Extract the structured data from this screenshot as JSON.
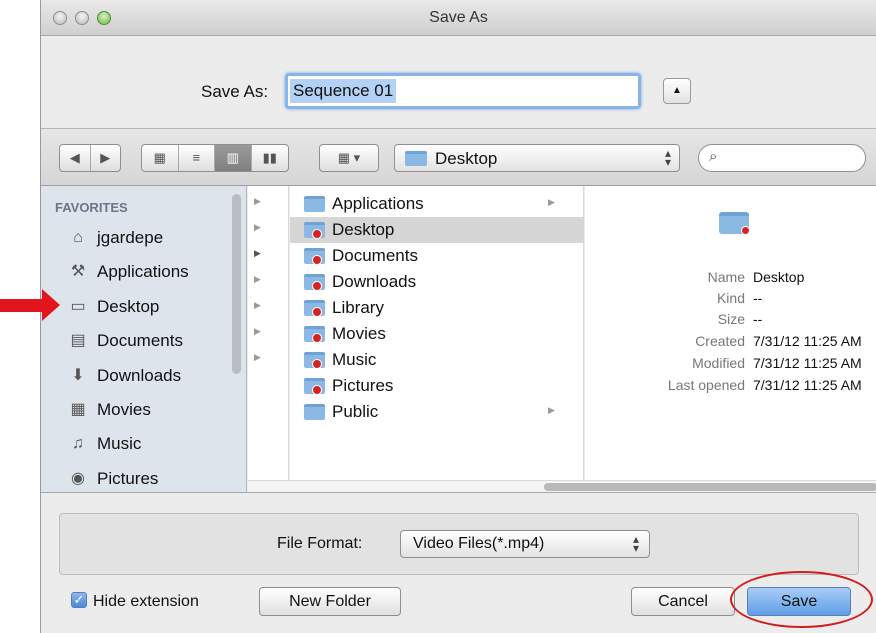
{
  "window": {
    "title": "Save As"
  },
  "save_as": {
    "label": "Save As:",
    "filename": "Sequence 01"
  },
  "toolbar": {
    "back_icon": "back-arrow-icon",
    "forward_icon": "forward-arrow-icon",
    "location": "Desktop",
    "search_placeholder": ""
  },
  "sidebar": {
    "header": "FAVORITES",
    "items": [
      {
        "label": "jgardepe",
        "icon": "home-icon"
      },
      {
        "label": "Applications",
        "icon": "applications-icon"
      },
      {
        "label": "Desktop",
        "icon": "desktop-icon"
      },
      {
        "label": "Documents",
        "icon": "documents-icon"
      },
      {
        "label": "Downloads",
        "icon": "downloads-icon"
      },
      {
        "label": "Movies",
        "icon": "movies-icon"
      },
      {
        "label": "Music",
        "icon": "music-icon"
      },
      {
        "label": "Pictures",
        "icon": "pictures-icon"
      }
    ]
  },
  "browser": {
    "items": [
      {
        "label": "Applications",
        "badge": false,
        "chevron": true
      },
      {
        "label": "Desktop",
        "badge": true,
        "chevron": false,
        "selected": true
      },
      {
        "label": "Documents",
        "badge": true,
        "chevron": false
      },
      {
        "label": "Downloads",
        "badge": true,
        "chevron": false
      },
      {
        "label": "Library",
        "badge": true,
        "chevron": false
      },
      {
        "label": "Movies",
        "badge": true,
        "chevron": false
      },
      {
        "label": "Music",
        "badge": true,
        "chevron": false
      },
      {
        "label": "Pictures",
        "badge": true,
        "chevron": false
      },
      {
        "label": "Public",
        "badge": false,
        "chevron": true
      }
    ]
  },
  "preview": {
    "name_label": "Name",
    "name_value": "Desktop",
    "kind_label": "Kind",
    "kind_value": "--",
    "size_label": "Size",
    "size_value": "--",
    "created_label": "Created",
    "created_value": "7/31/12 11:25 AM",
    "modified_label": "Modified",
    "modified_value": "7/31/12 11:25 AM",
    "opened_label": "Last opened",
    "opened_value": "7/31/12 11:25 AM"
  },
  "format": {
    "label": "File Format:",
    "value": "Video Files(*.mp4)"
  },
  "footer": {
    "hide_extension_label": "Hide extension",
    "hide_extension_checked": true,
    "new_folder_label": "New Folder",
    "cancel_label": "Cancel",
    "save_label": "Save"
  },
  "colors": {
    "accent": "#5f9ee6",
    "annotation": "#e3151c"
  }
}
